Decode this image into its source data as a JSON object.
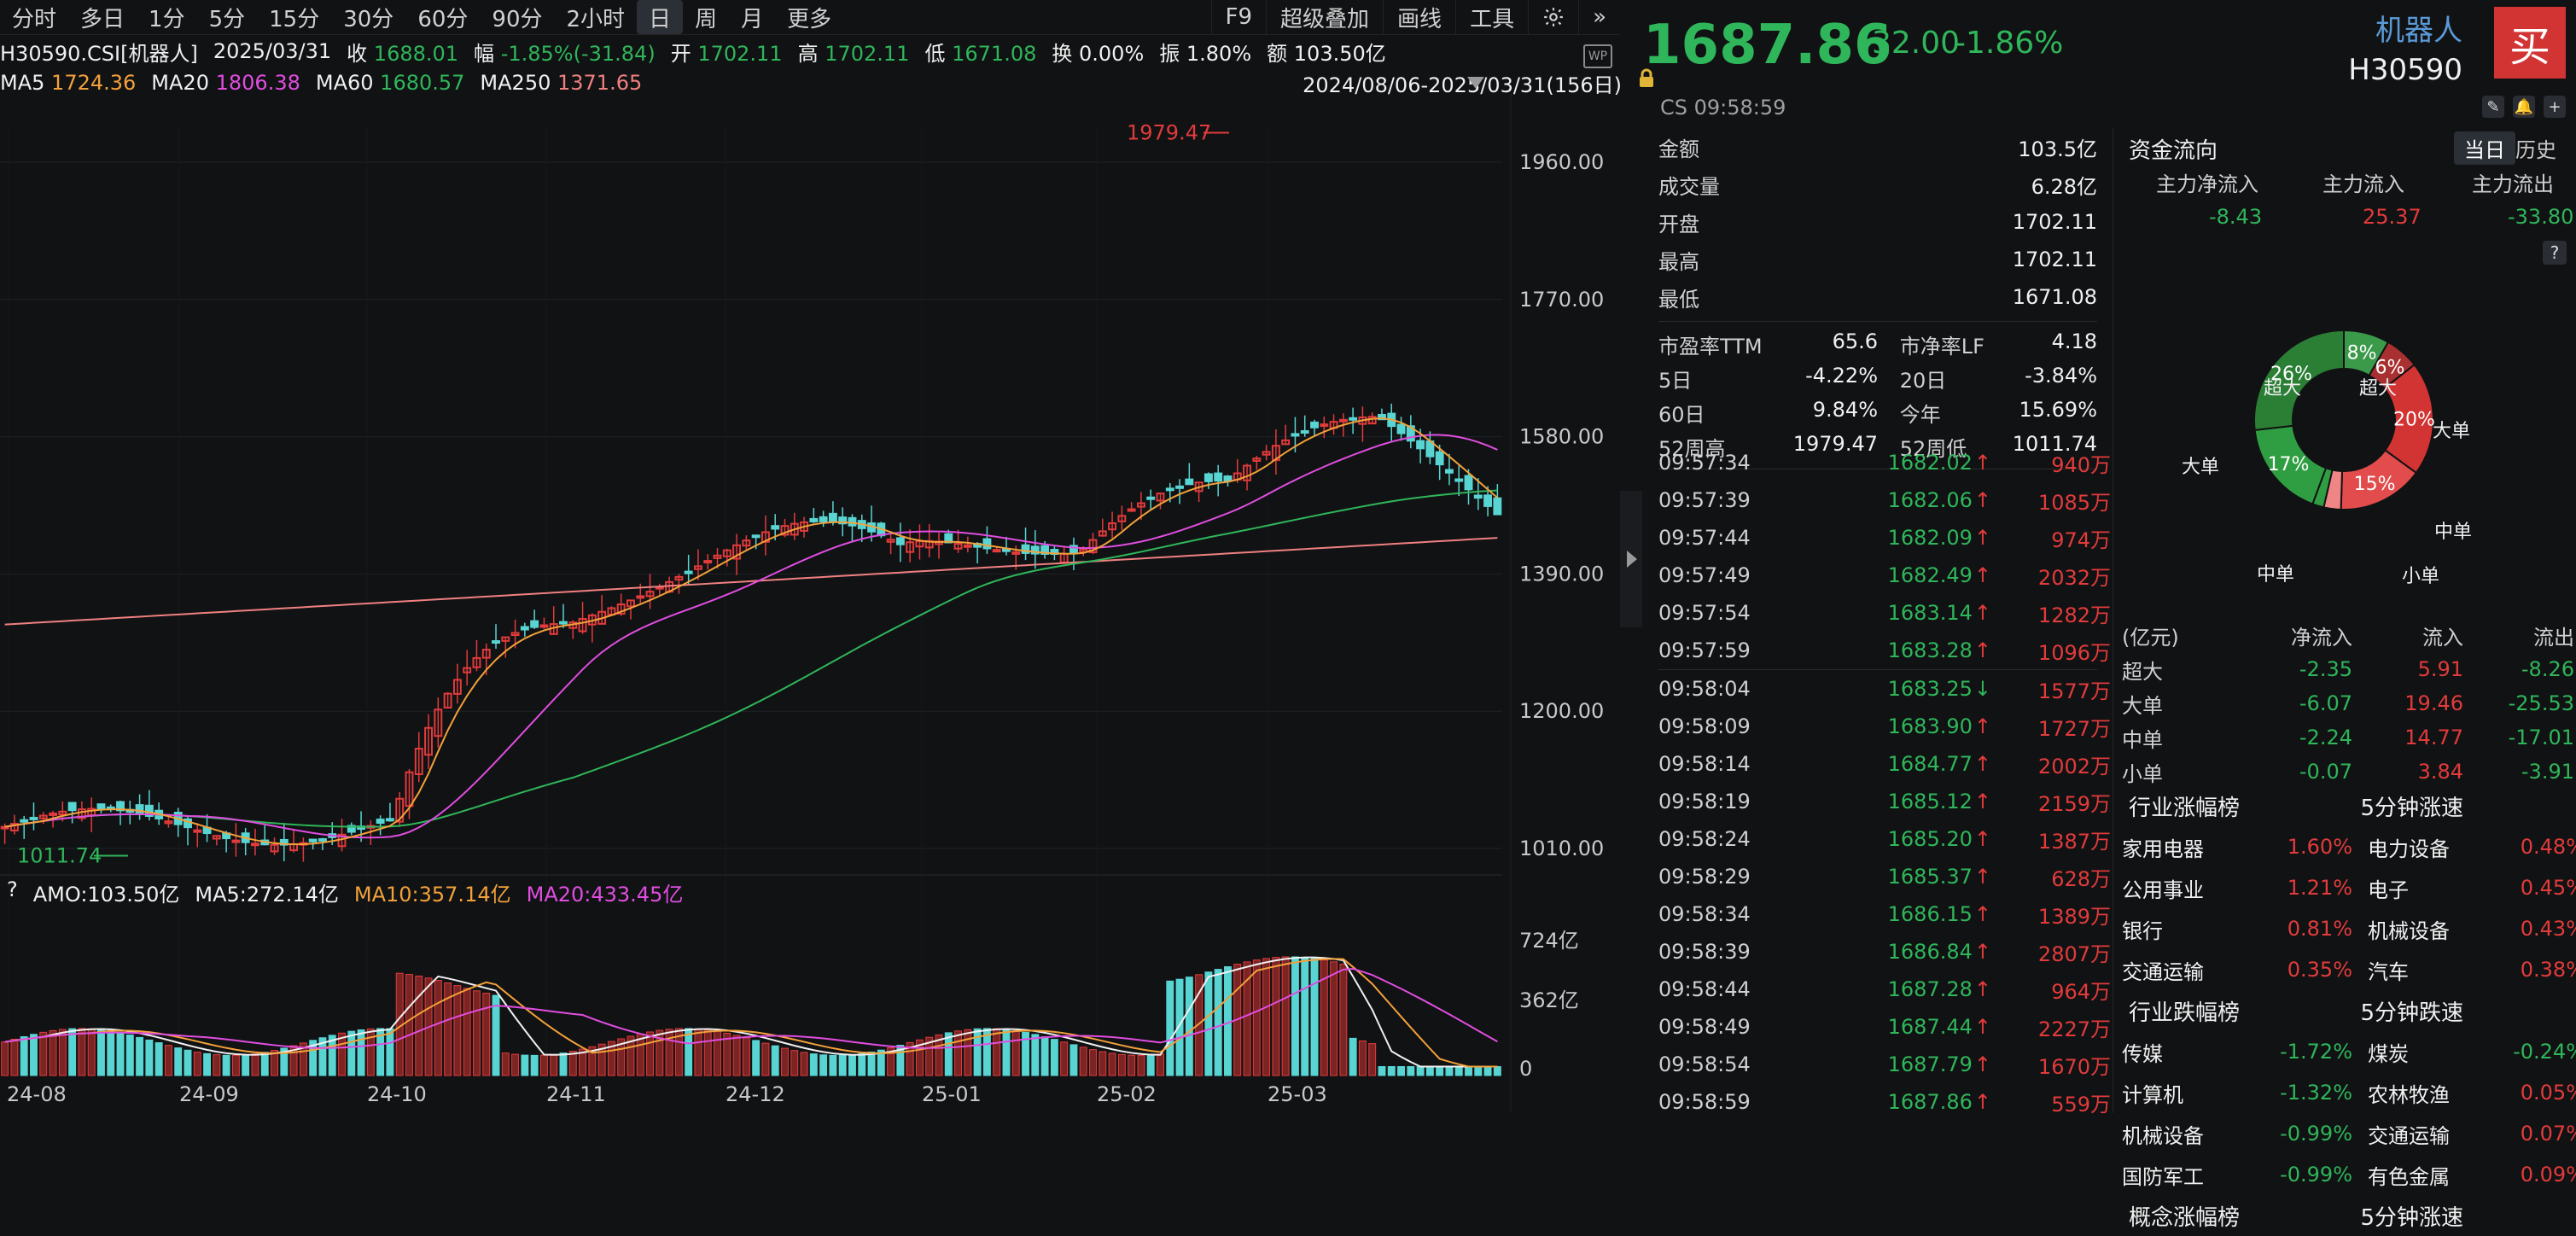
{
  "toolbar": {
    "periods": [
      "分时",
      "多日",
      "1分",
      "5分",
      "15分",
      "30分",
      "60分",
      "90分",
      "2小时",
      "日",
      "周",
      "月",
      "更多"
    ],
    "active_period": "日",
    "right_buttons": [
      "F9",
      "超级叠加",
      "画线",
      "工具"
    ]
  },
  "quote": {
    "code_name": "H30590.CSI[机器人]",
    "date": "2025/03/31",
    "close_label": "收",
    "close": "1688.01",
    "change_label": "幅",
    "change": "-1.85%(-31.84)",
    "open_label": "开",
    "open": "1702.11",
    "high_label": "高",
    "high": "1702.11",
    "low_label": "低",
    "low": "1671.08",
    "turnover_label": "换",
    "turnover": "0.00%",
    "amplitude_label": "振",
    "amplitude": "1.80%",
    "amount_label": "额",
    "amount": "103.50亿"
  },
  "ma": {
    "ma5_label": "MA5",
    "ma5": "1724.36",
    "ma20_label": "MA20",
    "ma20": "1806.38",
    "ma60_label": "MA60",
    "ma60": "1680.57",
    "ma250_label": "MA250",
    "ma250": "1371.65"
  },
  "range_label": "2024/08/06-2025/03/31(156日)",
  "price_axis": [
    "1960.00",
    "1770.00",
    "1580.00",
    "1390.00",
    "1200.00",
    "1010.00"
  ],
  "annotations": {
    "high": "1979.47",
    "low": "1011.74"
  },
  "volume": {
    "header_q": "?",
    "amo": "AMO:103.50亿",
    "ma5": "MA5:272.14亿",
    "ma10": "MA10:357.14亿",
    "ma20": "MA20:433.45亿",
    "axis": [
      "724亿",
      "362亿",
      "0"
    ]
  },
  "x_axis": [
    "24-08",
    "24-09",
    "24-10",
    "24-11",
    "24-12",
    "25-01",
    "25-02",
    "25-03"
  ],
  "right": {
    "price": "1687.86",
    "change": "-32.00",
    "change_pct": "-1.86%",
    "name": "机器人",
    "code": "H30590",
    "buy_label": "买",
    "cs_line": "CS  09:58:59",
    "stats": [
      {
        "k": "金额",
        "v": "103.5亿"
      },
      {
        "k": "成交量",
        "v": "6.28亿"
      },
      {
        "k": "开盘",
        "v": "1702.11"
      },
      {
        "k": "最高",
        "v": "1702.11"
      },
      {
        "k": "最低",
        "v": "1671.08"
      }
    ],
    "ratios": {
      "pe_label": "市盈率TTM",
      "pe": "65.6",
      "pb_label": "市净率LF",
      "pb": "4.18",
      "d5_label": "5日",
      "d5": "-4.22%",
      "d20_label": "20日",
      "d20": "-3.84%",
      "d60_label": "60日",
      "d60": "9.84%",
      "ytd_label": "今年",
      "ytd": "15.69%",
      "h52_label": "52周高",
      "h52": "1979.47",
      "l52_label": "52周低",
      "l52": "1011.74"
    },
    "trades": [
      {
        "t": "09:57:34",
        "p": "1682.02",
        "dir": "up",
        "v": "940万"
      },
      {
        "t": "09:57:39",
        "p": "1682.06",
        "dir": "up",
        "v": "1085万"
      },
      {
        "t": "09:57:44",
        "p": "1682.09",
        "dir": "up",
        "v": "974万"
      },
      {
        "t": "09:57:49",
        "p": "1682.49",
        "dir": "up",
        "v": "2032万"
      },
      {
        "t": "09:57:54",
        "p": "1683.14",
        "dir": "up",
        "v": "1282万"
      },
      {
        "t": "09:57:59",
        "p": "1683.28",
        "dir": "up",
        "v": "1096万"
      },
      {
        "t": "09:58:04",
        "p": "1683.25",
        "dir": "down",
        "v": "1577万"
      },
      {
        "t": "09:58:09",
        "p": "1683.90",
        "dir": "up",
        "v": "1727万"
      },
      {
        "t": "09:58:14",
        "p": "1684.77",
        "dir": "up",
        "v": "2002万"
      },
      {
        "t": "09:58:19",
        "p": "1685.12",
        "dir": "up",
        "v": "2159万"
      },
      {
        "t": "09:58:24",
        "p": "1685.20",
        "dir": "up",
        "v": "1387万"
      },
      {
        "t": "09:58:29",
        "p": "1685.37",
        "dir": "up",
        "v": "628万"
      },
      {
        "t": "09:58:34",
        "p": "1686.15",
        "dir": "up",
        "v": "1389万"
      },
      {
        "t": "09:58:39",
        "p": "1686.84",
        "dir": "up",
        "v": "2807万"
      },
      {
        "t": "09:58:44",
        "p": "1687.28",
        "dir": "up",
        "v": "964万"
      },
      {
        "t": "09:58:49",
        "p": "1687.44",
        "dir": "up",
        "v": "2227万"
      },
      {
        "t": "09:58:54",
        "p": "1687.79",
        "dir": "up",
        "v": "1670万"
      },
      {
        "t": "09:58:59",
        "p": "1687.86",
        "dir": "up",
        "v": "559万"
      }
    ],
    "flow": {
      "title": "资金流向",
      "tab_today": "当日",
      "tab_hist": "历史",
      "main_net_label": "主力净流入",
      "main_net": "-8.43",
      "main_in_label": "主力流入",
      "main_in": "25.37",
      "main_out_label": "主力流出",
      "main_out": "-33.80",
      "q": "?",
      "pie_labels": {
        "chaoda": "超大",
        "dadan": "大单",
        "zhongdan": "中单",
        "xiaodan": "小单"
      },
      "pie_percents": {
        "g1": "8%",
        "r1": "6%",
        "r2": "20%",
        "r3": "15%",
        "g2": "26%",
        "g3": "17%"
      },
      "table_head": [
        "(亿元)",
        "净流入",
        "流入",
        "流出"
      ],
      "table": [
        [
          "超大",
          "-2.35",
          "5.91",
          "-8.26"
        ],
        [
          "大单",
          "-6.07",
          "19.46",
          "-25.53"
        ],
        [
          "中单",
          "-2.24",
          "14.77",
          "-17.01"
        ],
        [
          "小单",
          "-0.07",
          "3.84",
          "-3.91"
        ]
      ],
      "rank1_title": "行业涨幅榜",
      "rank1_title2": "5分钟涨速",
      "rank1": [
        [
          "家用电器",
          "1.60%",
          "电力设备",
          "0.48%"
        ],
        [
          "公用事业",
          "1.21%",
          "电子",
          "0.45%"
        ],
        [
          "银行",
          "0.81%",
          "机械设备",
          "0.43%"
        ],
        [
          "交通运输",
          "0.35%",
          "汽车",
          "0.38%"
        ]
      ],
      "rank2_title": "行业跌幅榜",
      "rank2_title2": "5分钟跌速",
      "rank2": [
        [
          "传媒",
          "-1.72%",
          "煤炭",
          "-0.24%"
        ],
        [
          "计算机",
          "-1.32%",
          "农林牧渔",
          "0.05%"
        ],
        [
          "机械设备",
          "-0.99%",
          "交通运输",
          "0.07%"
        ],
        [
          "国防军工",
          "-0.99%",
          "有色金属",
          "0.09%"
        ]
      ],
      "rank3_title": "概念涨幅榜",
      "rank3_title2": "5分钟涨速"
    }
  },
  "colors": {
    "up": "#e23b3b",
    "down": "#2fb65a",
    "cyan": "#58d5d3",
    "ma5": "#f2a13a",
    "ma20": "#e04de0",
    "ma60": "#2fb65a",
    "ma250": "#f08080"
  }
}
